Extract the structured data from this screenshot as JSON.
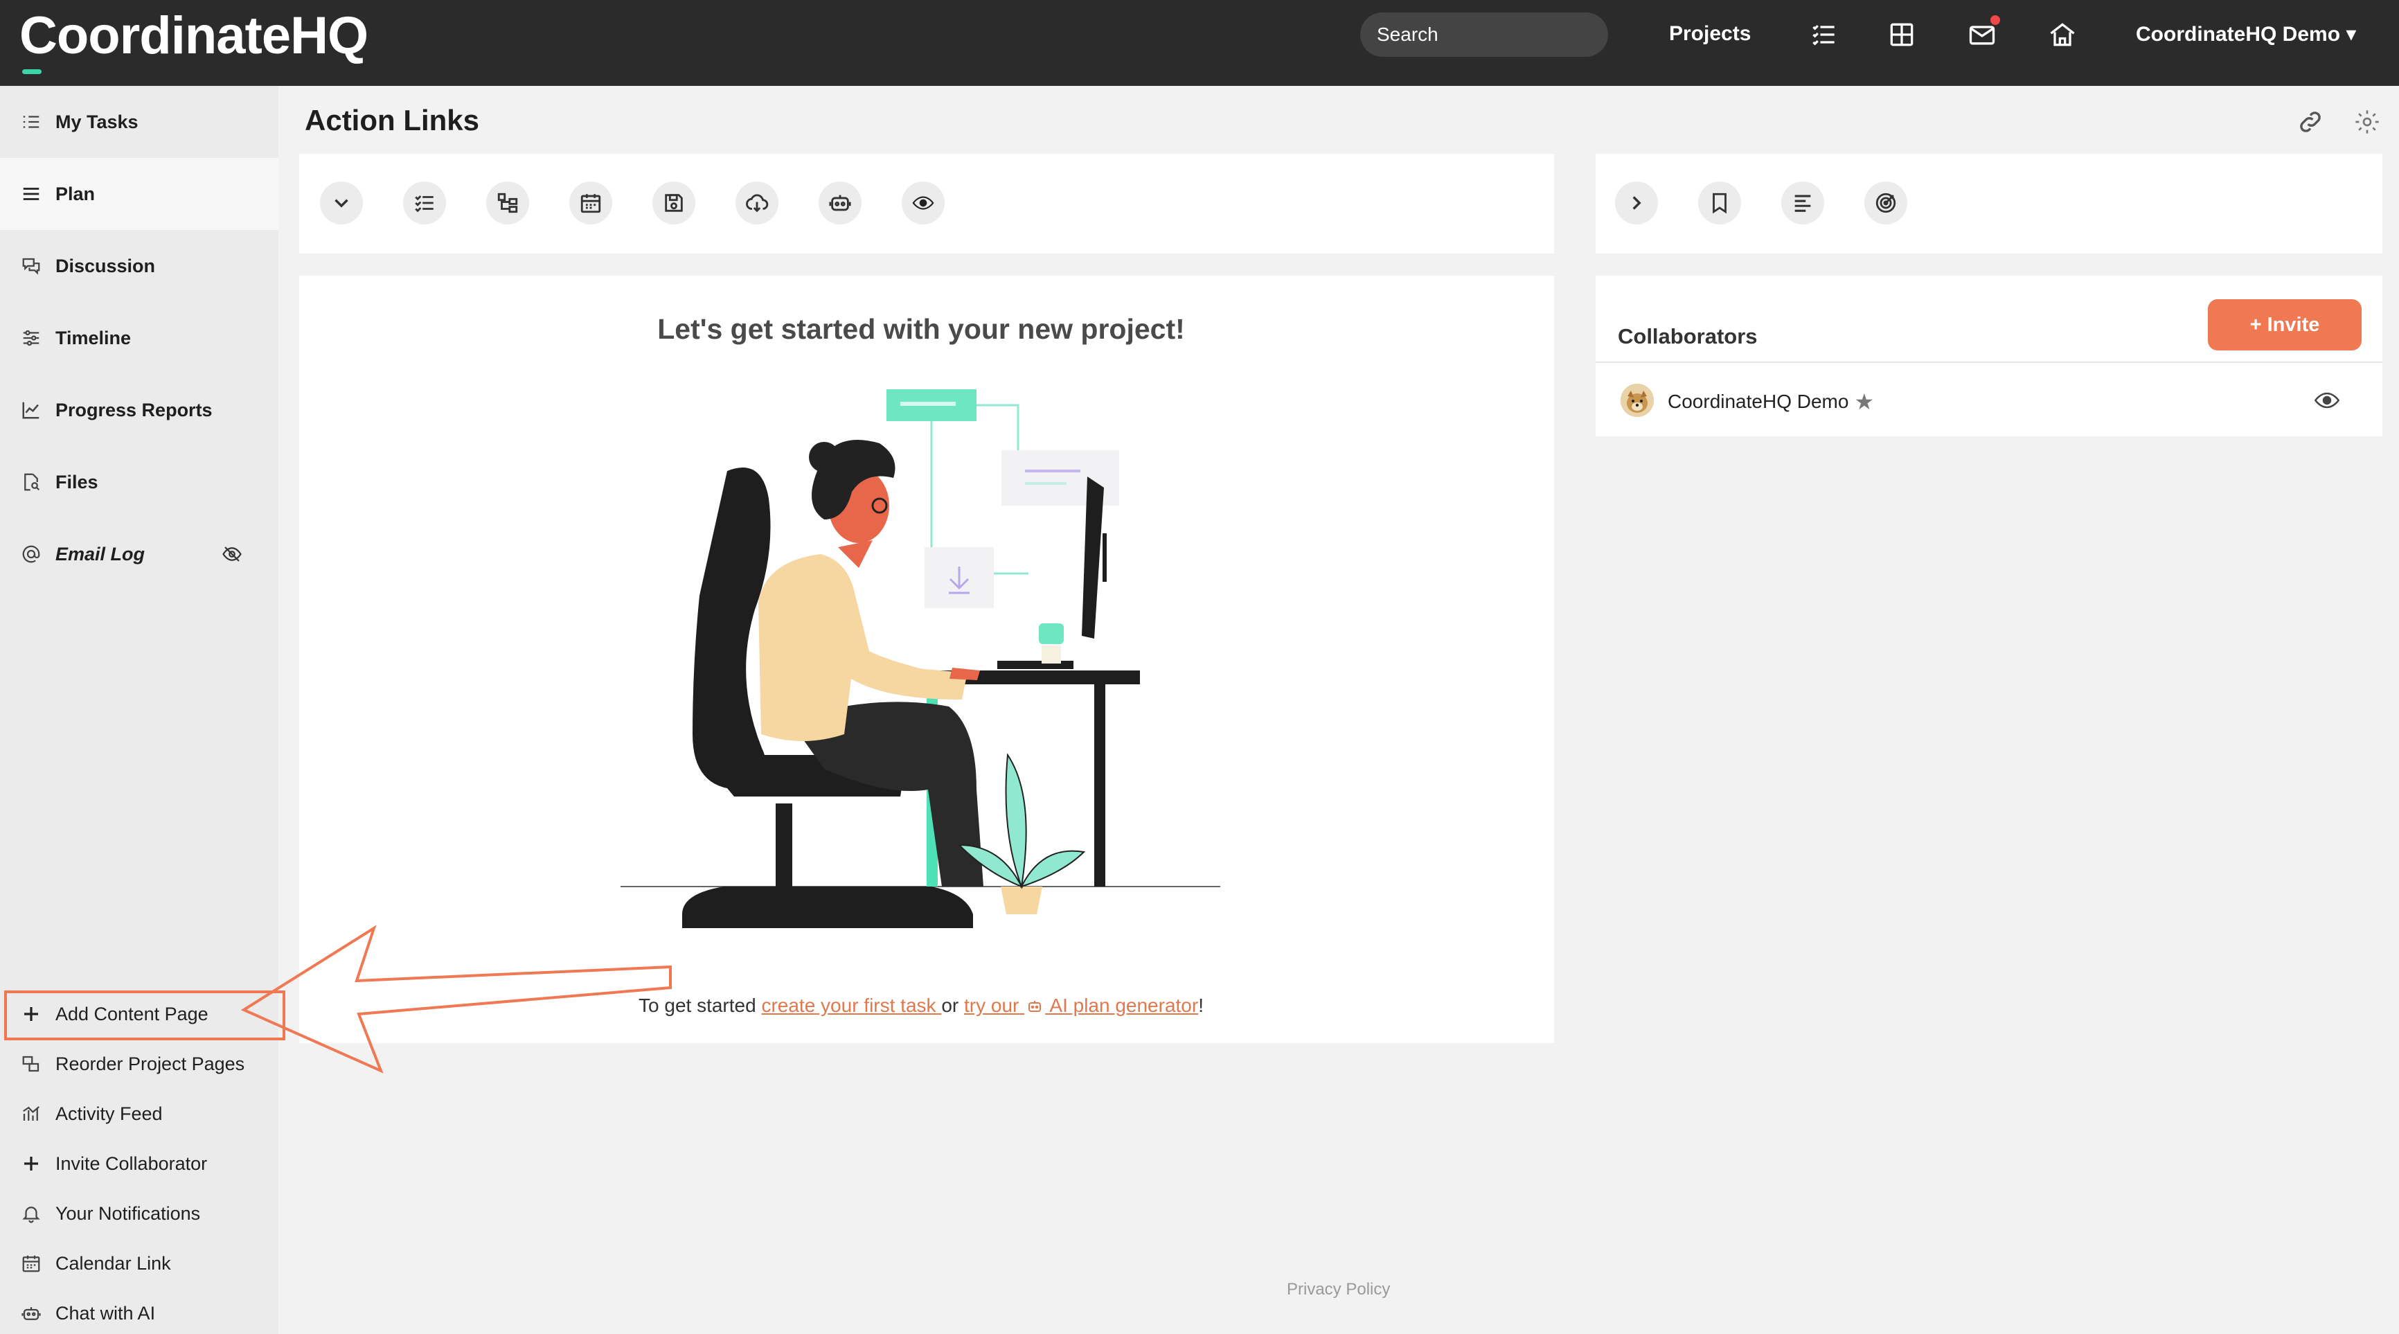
{
  "app": {
    "logo_text": "CoordinateHQ",
    "search_placeholder": "Search",
    "nav_projects": "Projects",
    "user_menu": "CoordinateHQ Demo ▾",
    "accent_color": "#f07852",
    "brand_green": "#3ad6a8"
  },
  "sidebar": {
    "primary": [
      {
        "label": "My Tasks",
        "icon": "list-check-icon"
      },
      {
        "label": "Plan",
        "icon": "menu-lines-icon"
      },
      {
        "label": "Discussion",
        "icon": "chat-bubbles-icon"
      },
      {
        "label": "Timeline",
        "icon": "sliders-icon"
      },
      {
        "label": "Progress Reports",
        "icon": "line-chart-icon"
      },
      {
        "label": "Files",
        "icon": "file-search-icon"
      },
      {
        "label": "Email Log",
        "icon": "at-sign-icon"
      }
    ],
    "secondary": [
      {
        "label": "Add Content Page",
        "icon": "plus-icon"
      },
      {
        "label": "Reorder Project Pages",
        "icon": "reorder-icon"
      },
      {
        "label": "Activity Feed",
        "icon": "activity-chart-icon"
      },
      {
        "label": "Invite Collaborator",
        "icon": "plus-icon"
      },
      {
        "label": "Your Notifications",
        "icon": "bell-icon"
      },
      {
        "label": "Calendar Link",
        "icon": "calendar-icon"
      },
      {
        "label": "Chat with AI",
        "icon": "robot-icon"
      }
    ]
  },
  "main": {
    "title": "Action Links",
    "hero_title": "Let's get started with your new project!",
    "cta": {
      "prefix": "To get started ",
      "link1": "create your first task ",
      "middle": "or ",
      "link2_part1": "try our ",
      "link2_part2": " AI plan generator",
      "suffix": "!"
    }
  },
  "collaborators": {
    "title": "Collaborators",
    "invite_label": "+ Invite",
    "members": [
      {
        "name": "CoordinateHQ Demo",
        "owner_star": "★"
      }
    ]
  },
  "footer": {
    "privacy": "Privacy Policy"
  }
}
